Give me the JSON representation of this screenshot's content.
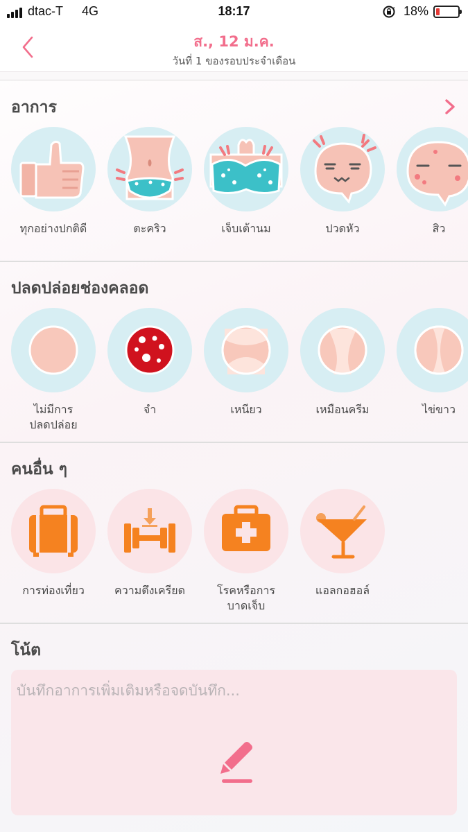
{
  "status_bar": {
    "carrier": "dtac-T",
    "network": "4G",
    "time": "18:17",
    "battery_percent": "18%",
    "battery_level": 0.18
  },
  "header": {
    "back_icon": "chevron-left-icon",
    "title": "ส., 12 ม.ค.",
    "subtitle": "วันที่ 1 ของรอบประจำเดือน",
    "accent_color": "#f26e8c"
  },
  "symptoms": {
    "title": "อาการ",
    "more_icon": "chevron-right-icon",
    "items": [
      {
        "label": "ทุกอย่างปกติดี",
        "icon": "thumbs-up-icon"
      },
      {
        "label": "ตะคริว",
        "icon": "cramps-belly-icon"
      },
      {
        "label": "เจ็บเต้านม",
        "icon": "breast-tenderness-icon"
      },
      {
        "label": "ปวดหัว",
        "icon": "headache-face-icon"
      },
      {
        "label": "สิว",
        "icon": "acne-face-icon"
      }
    ]
  },
  "discharge": {
    "title": "ปลดปล่อยช่องคลอด",
    "items": [
      {
        "label": "ไม่มีการ\nปลดปล่อย",
        "line1": "ไม่มีการ",
        "line2": "ปลดปล่อย",
        "icon": "no-discharge-icon"
      },
      {
        "label": "จำ",
        "icon": "spotting-icon"
      },
      {
        "label": "เหนียว",
        "icon": "sticky-discharge-icon"
      },
      {
        "label": "เหมือนครีม",
        "icon": "creamy-discharge-icon"
      },
      {
        "label": "ไข่ขาว",
        "icon": "egg-white-discharge-icon"
      }
    ]
  },
  "others": {
    "title": "คนอื่น ๆ",
    "items": [
      {
        "label": "การท่องเที่ยว",
        "icon": "suitcase-icon"
      },
      {
        "label": "ความตึงเครียด",
        "icon": "dumbbell-stress-icon"
      },
      {
        "label": "โรคหรือการ\nบาดเจ็บ",
        "line1": "โรคหรือการ",
        "line2": "บาดเจ็บ",
        "icon": "first-aid-kit-icon"
      },
      {
        "label": "แอลกอฮอล์",
        "icon": "cocktail-icon"
      }
    ]
  },
  "notes": {
    "title": "โน้ต",
    "placeholder": "บันทึกอาการเพิ่มเติมหรือจดบันทึก...",
    "edit_icon": "pencil-icon"
  }
}
